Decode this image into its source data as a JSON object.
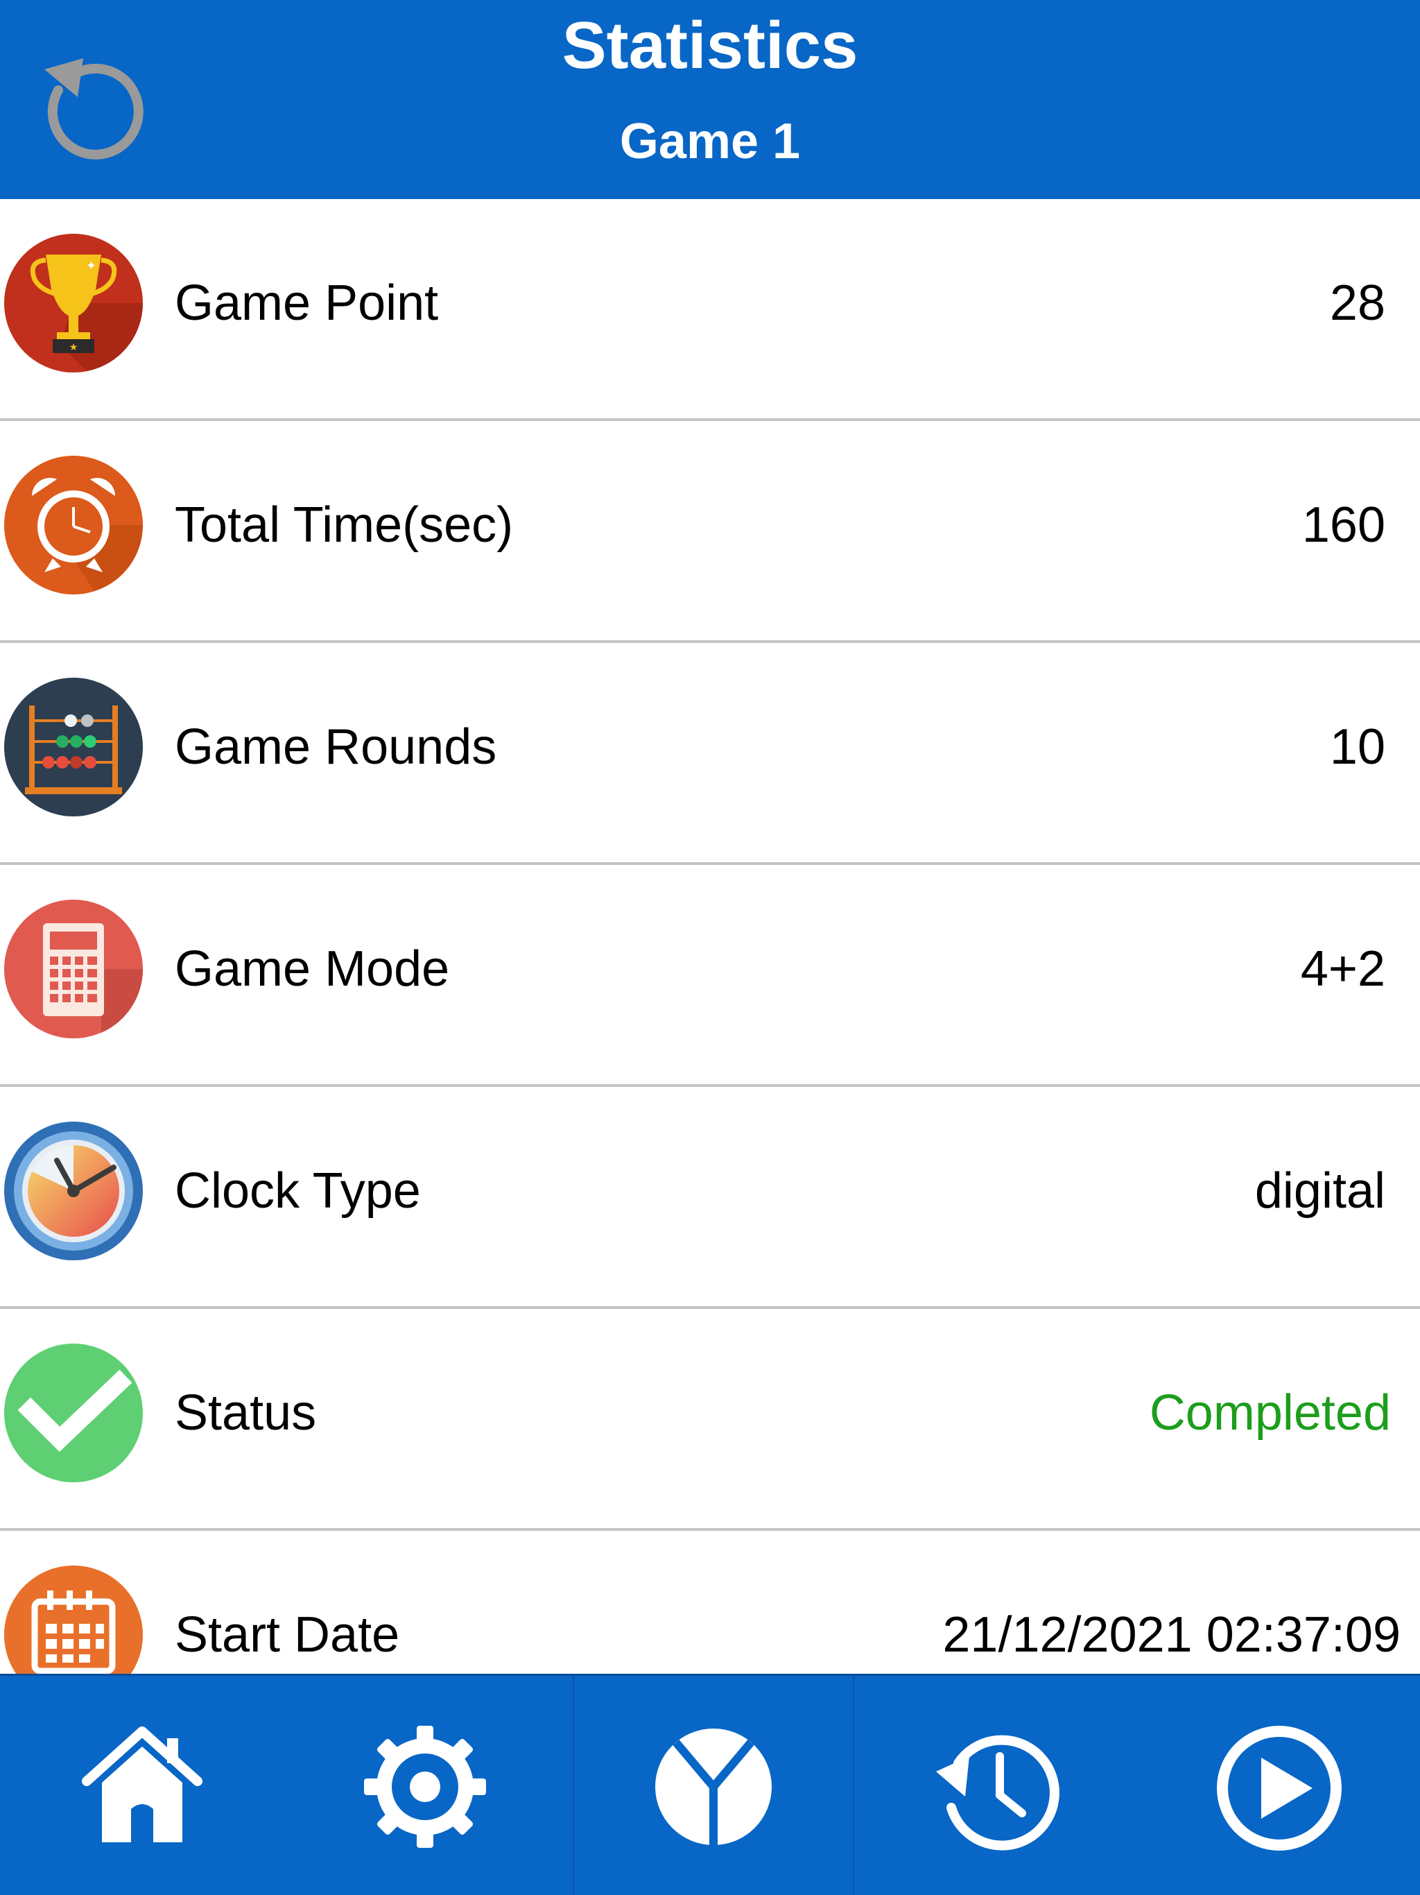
{
  "header": {
    "title": "Statistics",
    "subtitle": "Game 1"
  },
  "stats": {
    "game_point": {
      "label": "Game Point",
      "value": "28",
      "icon": "trophy-icon"
    },
    "total_time": {
      "label": "Total Time(sec)",
      "value": "160",
      "icon": "alarm-clock-icon"
    },
    "game_rounds": {
      "label": "Game Rounds",
      "value": "10",
      "icon": "abacus-icon"
    },
    "game_mode": {
      "label": "Game Mode",
      "value": "4+2",
      "icon": "calculator-icon"
    },
    "clock_type": {
      "label": "Clock Type",
      "value": "digital",
      "icon": "clock-icon"
    },
    "status": {
      "label": "Status",
      "value": "Completed",
      "icon": "checkmark-icon"
    },
    "start_date": {
      "label": "Start Date",
      "value": "21/12/2021 02:37:09",
      "icon": "calendar-icon"
    }
  },
  "tabbar": {
    "tabs": [
      "home-icon",
      "settings-gear-icon",
      "stats-pie-icon",
      "history-icon",
      "play-icon"
    ]
  },
  "colors": {
    "primary": "#0866c6",
    "status_completed": "#1c9e1c",
    "divider": "#c4c4c4"
  }
}
